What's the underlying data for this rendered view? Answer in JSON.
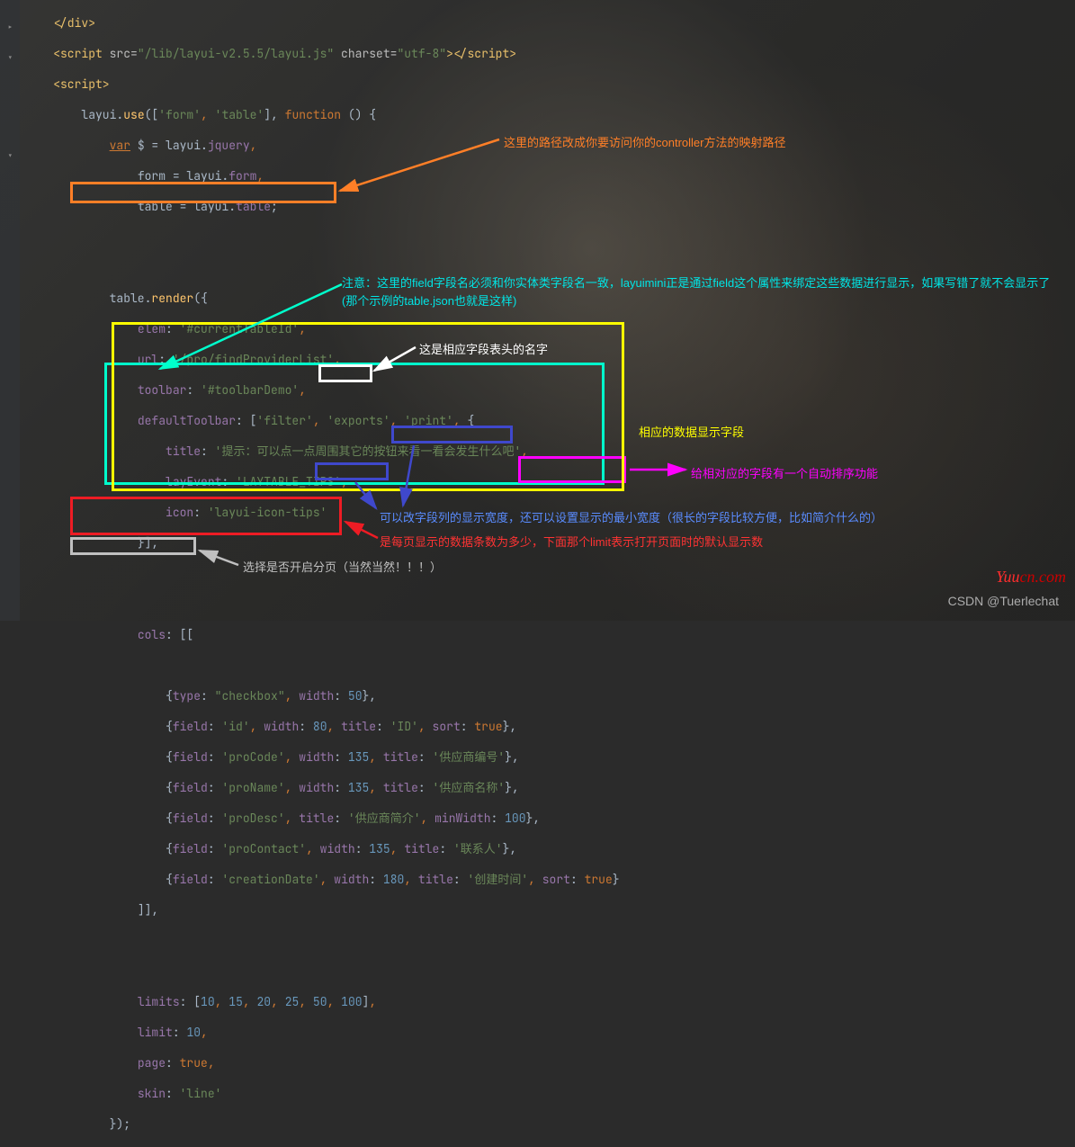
{
  "code": {
    "l1": "</div>",
    "l2_a": "<script",
    "l2_b": "src=",
    "l2_c": "\"/lib/layui-v2.5.5/layui.js\"",
    "l2_d": "charset=",
    "l2_e": "\"utf-8\"",
    "l2_f": "></",
    "l2_g": "script",
    "l2_h": ">",
    "l3_a": "<script>",
    "l4": "layui.",
    "l4_fn": "use",
    "l4_b": "([",
    "l4_s1": "'form'",
    "l4_c": ", ",
    "l4_s2": "'table'",
    "l4_d": "], ",
    "l4_kw": "function",
    "l4_e": " () {",
    "l5_kw": "var",
    "l5_b": " $ = layui.",
    "l5_p": "jquery",
    "l5_c": ",",
    "l6": "form = layui.",
    "l6_p": "form",
    "l6_c": ",",
    "l7": "table = layui.",
    "l7_p": "table",
    "l7_c": ";",
    "l9": "table.",
    "l9_fn": "render",
    "l9_b": "({",
    "l10_p": "elem",
    "l10_v": "'#currentTableId'",
    "l11_p": "url",
    "l11_v": "'/pro/findProviderList'",
    "l12_p": "toolbar",
    "l12_v": "'#toolbarDemo'",
    "l13_p": "defaultToolbar",
    "l13_v1": "'filter'",
    "l13_v2": "'exports'",
    "l13_v3": "'print'",
    "l14_p": "title",
    "l14_v": "'提示：可以点一点周围其它的按钮来看一看会发生什么吧'",
    "l15_p": "layEvent",
    "l15_v": "'LAYTABLE_TIPS'",
    "l16_p": "icon",
    "l16_v": "'layui-icon-tips'",
    "l17": "}],",
    "l18_p": "cols",
    "l18_b": ": [[",
    "l19_p": "type",
    "l19_v": "\"checkbox\"",
    "l19_wp": "width",
    "l19_wn": "50",
    "l20_fp": "field",
    "l20_fv": "'id'",
    "l20_wp": "width",
    "l20_wn": "80",
    "l20_tp": "title",
    "l20_tv": "'ID'",
    "l20_sp": "sort",
    "l20_sv": "true",
    "l21_fp": "field",
    "l21_fv": "'proCode'",
    "l21_wp": "width",
    "l21_wn": "135",
    "l21_tp": "title",
    "l21_tv": "'供应商编号'",
    "l22_fp": "field",
    "l22_fv": "'proName'",
    "l22_wp": "width",
    "l22_wn": "135",
    "l22_tp": "title",
    "l22_tv": "'供应商名称'",
    "l23_fp": "field",
    "l23_fv": "'proDesc'",
    "l23_tp": "title",
    "l23_tv": "'供应商简介'",
    "l23_mp": "minWidth",
    "l23_mn": "100",
    "l24_fp": "field",
    "l24_fv": "'proContact'",
    "l24_wp": "width",
    "l24_wn": "135",
    "l24_tp": "title",
    "l24_tv": "'联系人'",
    "l25_fp": "field",
    "l25_fv": "'creationDate'",
    "l25_wp": "width",
    "l25_wn": "180",
    "l25_tp": "title",
    "l25_tv": "'创建时间'",
    "l25_sp": "sort",
    "l25_sv": "true",
    "l26": "]],",
    "l27_p": "limits",
    "l27_v": "[10, 15, 20, 25, 50, 100]",
    "l28_p": "limit",
    "l28_v": "10",
    "l29_p": "page",
    "l29_v": "true",
    "l30_p": "skin",
    "l30_v": "'line'",
    "l31": "});"
  },
  "ann": {
    "orange": "这里的路径改成你要访问你的controller方法的映射路径",
    "cyan_l1": "注意：这里的field字段名必须和你实体类字段名一致，layuimini正是通过field这个属性来绑定这些数据进行显示，如果写错了就不会显示了",
    "cyan_l2": "(那个示例的table.json也就是这样)",
    "white": "这是相应字段表头的名字",
    "yellow": "相应的数据显示字段",
    "magenta": "给相对应的字段有一个自动排序功能",
    "blue": "可以改字段列的显示宽度，还可以设置显示的最小宽度（很长的字段比较方便，比如简介什么的）",
    "red": "是每页显示的数据条数为多少，下面那个limit表示打开页面时的默认显示数",
    "gray": "选择是否开启分页（当然当然！！！）"
  },
  "watermark": {
    "csdn": "CSDN @Tuerlechat",
    "brand1": "Yuu",
    "brand2": "cn.com"
  }
}
